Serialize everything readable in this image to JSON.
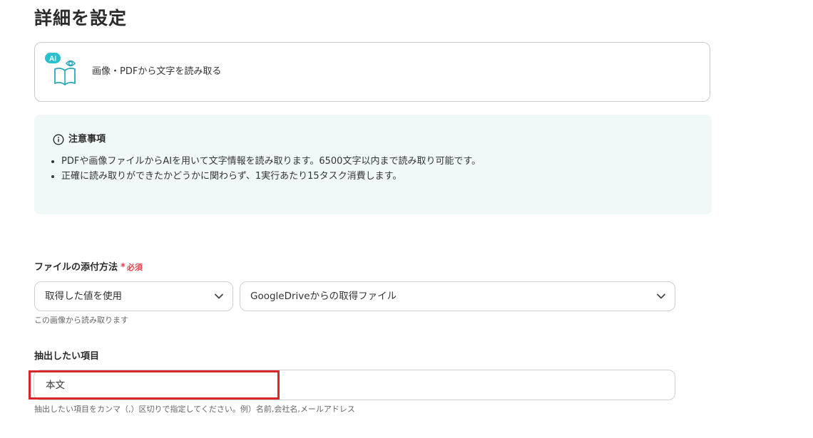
{
  "header": {
    "title": "詳細を設定"
  },
  "action": {
    "label": "画像・PDFから文字を読み取る",
    "ai_badge": "AI",
    "icon": "book-eye-icon"
  },
  "notice": {
    "title": "注意事項",
    "icon": "info-circle-icon",
    "items": [
      "PDFや画像ファイルからAIを用いて文字情報を読み取ります。6500文字以内まで読み取り可能です。",
      "正確に読み取りができたかどうかに関わらず、1実行あたり15タスク消費します。"
    ]
  },
  "form": {
    "attach_method": {
      "label": "ファイルの添付方法",
      "required_star": "*",
      "required_text": "必須",
      "select_type": "取得した値を使用",
      "select_file": "GoogleDriveからの取得ファイル",
      "hint": "この画像から読み取ります"
    },
    "extract": {
      "label": "抽出したい項目",
      "value": "本文",
      "hint": "抽出したい項目をカンマ（,）区切りで指定してください。例）名前,会社名,メールアドレス"
    }
  },
  "colors": {
    "accent": "#29b6c4",
    "required": "#e0454b",
    "highlight": "#d9262b",
    "notice_bg": "#f1f9f8"
  }
}
